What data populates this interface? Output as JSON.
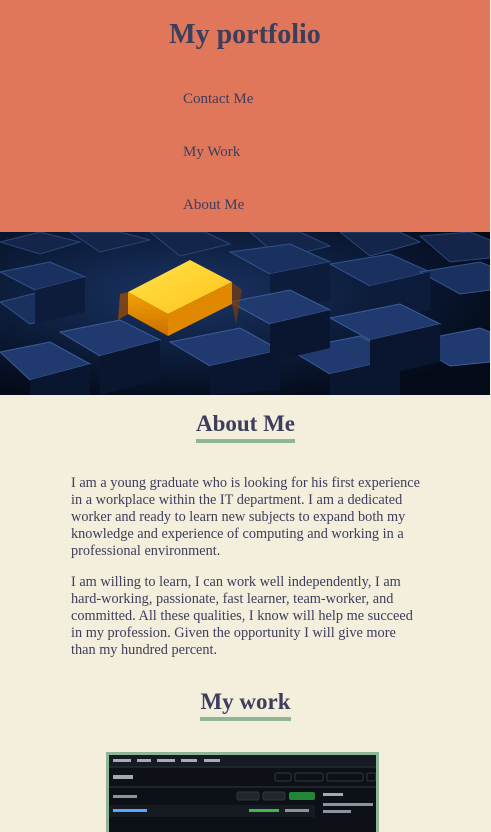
{
  "header": {
    "title": "My portfolio",
    "nav": [
      {
        "label": "Contact Me"
      },
      {
        "label": "My Work"
      },
      {
        "label": "About Me"
      }
    ],
    "background_color": "#e0775a",
    "text_color": "#3d3d5c"
  },
  "hero": {
    "image": "glowing-yellow-cube-among-dark-blue-cubes"
  },
  "about": {
    "heading": "About Me",
    "paragraphs": [
      "I am a young graduate who is looking for his first experience in a workplace within the IT department. I am a dedicated worker and ready to learn new subjects to expand both my knowledge and experience of computing and working in a professional environment.",
      "I am willing to learn, I can work well independently, I am hard-working, passionate, fast learner, team-worker, and committed. All these qualities, I know will help me succeed in my profession. Given the opportunity I will give more than my hundred percent."
    ]
  },
  "work": {
    "heading": "My work",
    "thumbnail": "github-repository-screenshot",
    "accent_color": "#8db596"
  },
  "page": {
    "background_color": "#f3efdc"
  }
}
